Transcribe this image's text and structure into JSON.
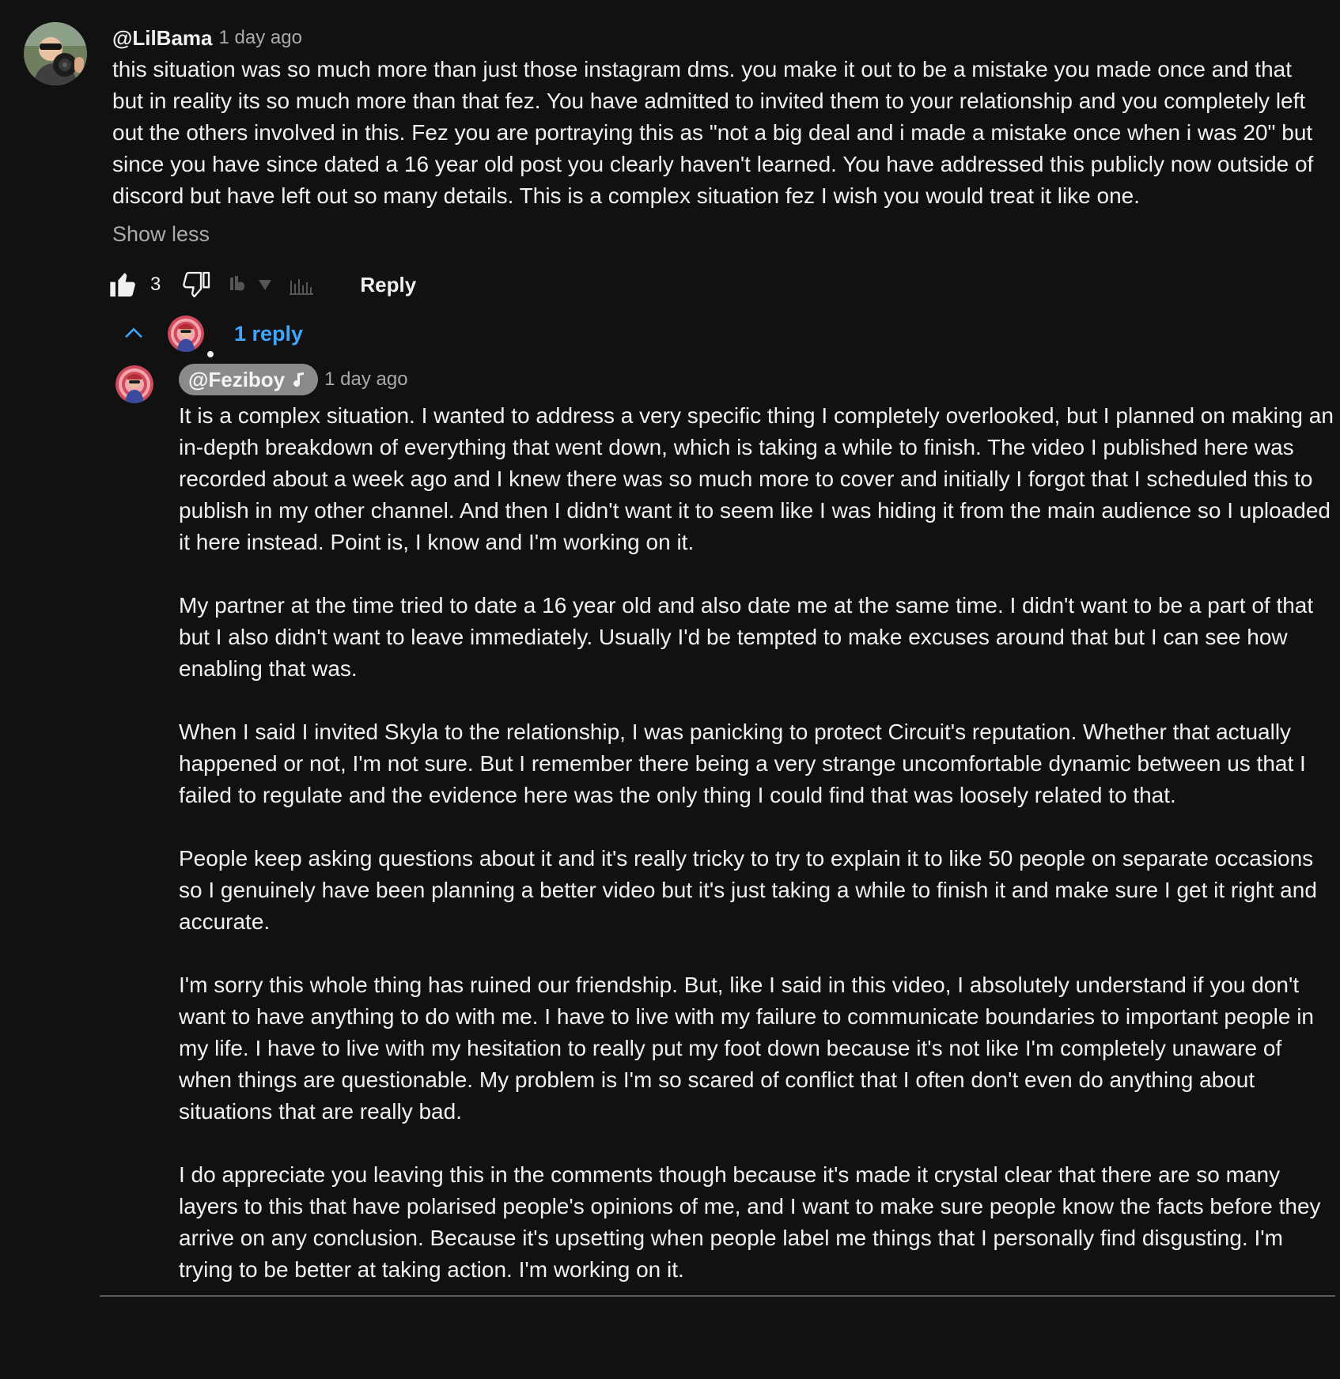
{
  "top_comment": {
    "author": "@LilBama",
    "time": "1 day ago",
    "text": "this situation was so much more than just those instagram dms. you make it out to be a mistake you made once and that but in reality its so much more than that fez. You have admitted to invited them to your relationship and you completely left out the others involved in this. Fez you are portraying this as \"not a big deal and i made a mistake once when i was 20\" but since you have since dated a 16 year old post you clearly haven't learned. You have addressed this publicly now outside of discord but have left out so many details. This is a complex situation fez I wish you would treat it like one.",
    "show_less_label": "Show less",
    "like_count": "3",
    "reply_label": "Reply",
    "avatar_icon": "user-avatar-camera",
    "like_icon": "thumbs-up-filled-icon",
    "dislike_icon": "thumbs-down-outline-icon",
    "extension_icons": [
      "ib-logo-icon",
      "triangle-down-icon",
      "bar-chart-icon"
    ]
  },
  "replies": {
    "count_label": "1 reply",
    "toggle_icon": "chevron-up-icon",
    "accent_color": "#3ea6ff"
  },
  "reply": {
    "author": "@Feziboy",
    "author_badge_icon": "music-note-icon",
    "time": "1 day ago",
    "paragraphs": [
      "It is a complex situation. I wanted to address a very specific thing I completely overlooked, but I planned on making an in-depth breakdown of everything that went down, which is taking a while to finish. The video I published here was recorded about a week ago and I knew there was so much more to cover and initially I forgot that I scheduled this to publish in my other channel. And then I didn't want it to seem like I was hiding it from the main audience so I uploaded it here instead. Point is, I know and I'm working on it.",
      "My partner at the time tried to date a 16 year old and also date me at the same time. I didn't want to be a part of that but I also didn't want to leave immediately. Usually I'd be tempted to make excuses around that but I can see how enabling that was.",
      "When I said I invited Skyla to the relationship, I was panicking to protect Circuit's reputation. Whether that actually happened or not, I'm not sure. But I remember there being a very strange uncomfortable dynamic between us that I failed to regulate and the evidence here was the only thing I could find that was loosely related to that.",
      "People keep asking questions about it and it's really tricky to try to explain it to like 50 people on separate occasions so I genuinely have been planning a better video but it's just taking a while to finish it and make sure I get it right and accurate.",
      "I'm sorry this whole thing has ruined our friendship. But, like I said in this video, I absolutely understand if you don't want to have anything to do with me. I have to live with my failure to communicate boundaries to important people in my life. I have to live with my hesitation to really put my foot down because it's not like I'm completely unaware of when things are questionable. My problem is I'm so scared of conflict that I often don't even do anything about situations that are really bad.",
      "I do appreciate you leaving this in the comments though because it's made it crystal clear that there are so many layers to this that have polarised people's opinions of me, and I want to make sure people know the facts before they arrive on any conclusion. Because it's upsetting when people label me things that I personally find disgusting. I'm trying to be better at taking action. I'm working on it."
    ]
  },
  "colors": {
    "background": "#111112",
    "text": "#f1f1f1",
    "secondary_text": "#aaaaaa",
    "link": "#3ea6ff",
    "chip_bg": "#8a8a8a",
    "divider": "#5b5b5b"
  }
}
